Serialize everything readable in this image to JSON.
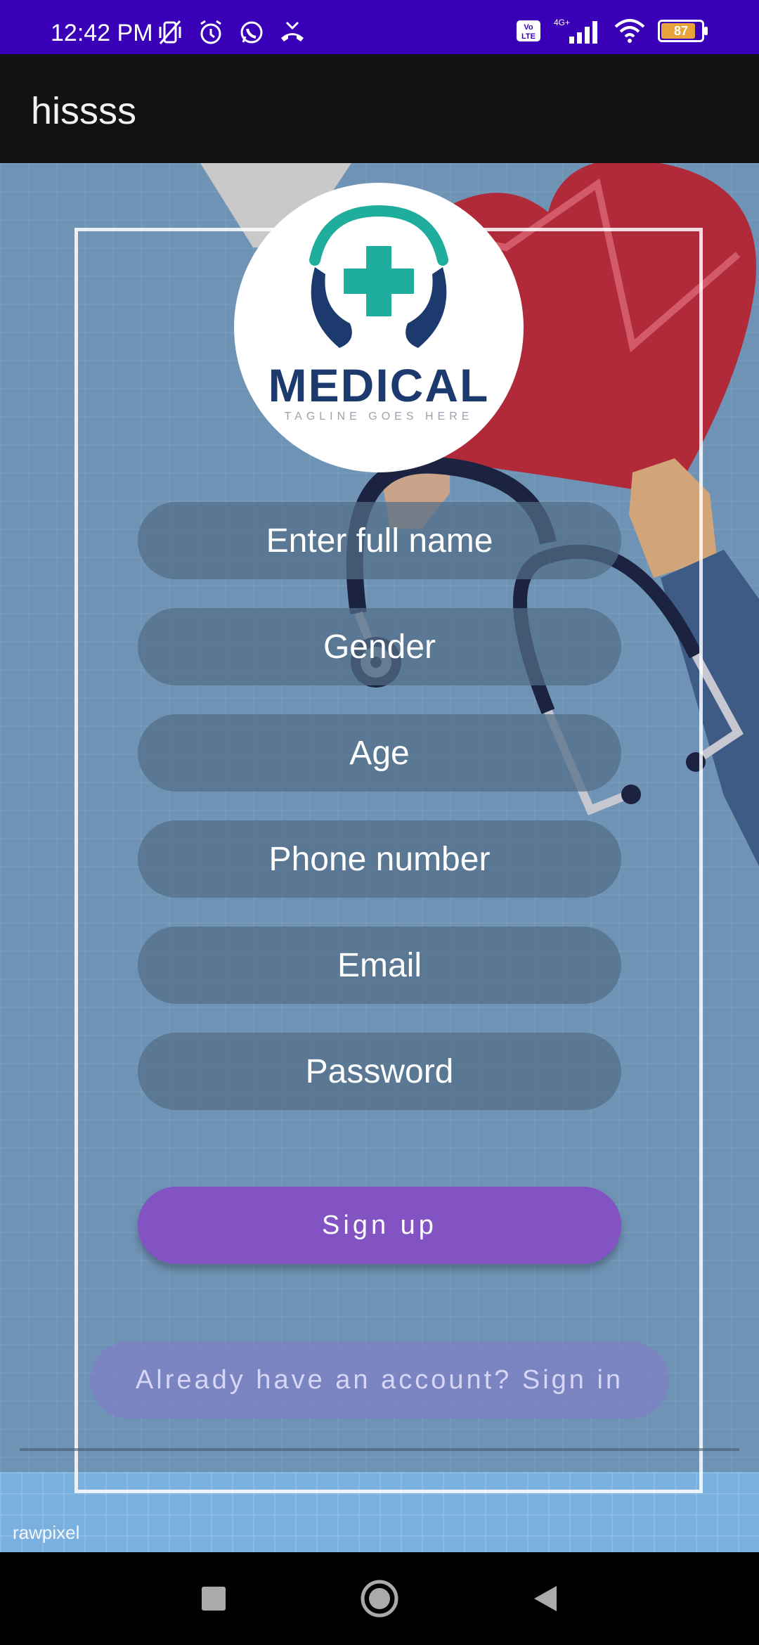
{
  "status_bar": {
    "time": "12:42 PM",
    "left_icons": [
      "mute-vibrate-icon",
      "alarm-icon",
      "whatsapp-icon",
      "missed-call-icon"
    ],
    "network_label": "4G+",
    "volte_label": "Vo LTE",
    "battery_level": "87"
  },
  "app_bar": {
    "title": "hissss"
  },
  "logo": {
    "word": "MEDICAL",
    "tagline": "TAGLINE GOES HERE"
  },
  "form": {
    "full_name_placeholder": "Enter full name",
    "gender_placeholder": "Gender",
    "age_placeholder": "Age",
    "phone_placeholder": "Phone number",
    "email_placeholder": "Email",
    "password_placeholder": "Password"
  },
  "buttons": {
    "signup_label": "Sign up",
    "signin_label": "Already have an account? Sign in"
  },
  "watermark": "rawpixel",
  "colors": {
    "status_bar": "#3a00b8",
    "app_bar": "#121212",
    "primary_button": "#8352c3",
    "background": "#6f93b5"
  },
  "nav_bar": {
    "icons": [
      "recents-square-icon",
      "home-circle-icon",
      "back-triangle-icon"
    ]
  }
}
